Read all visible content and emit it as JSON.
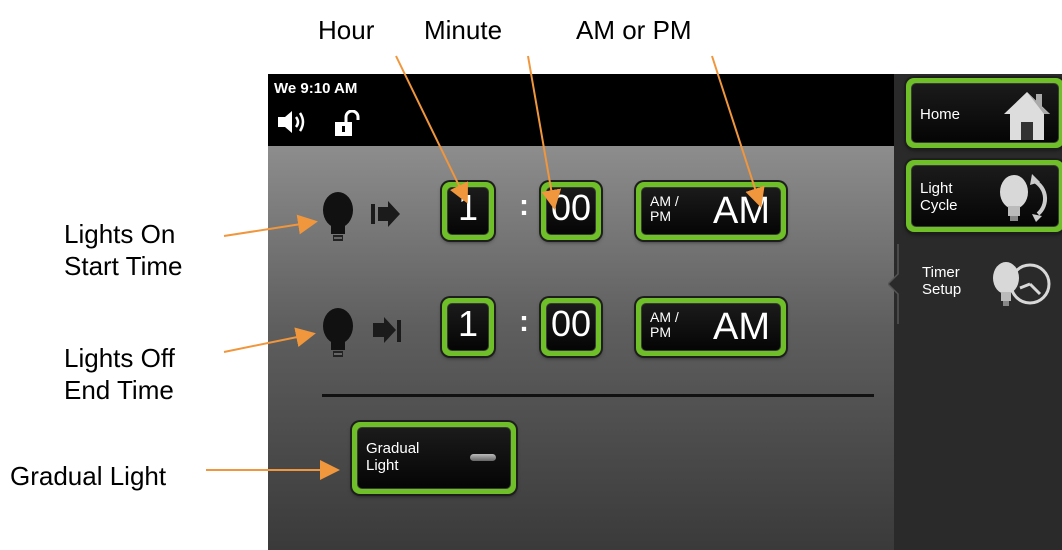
{
  "callouts": {
    "hour": "Hour",
    "minute": "Minute",
    "am_or_pm": "AM or PM",
    "lights_on_line1": "Lights On",
    "lights_on_line2": "Start Time",
    "lights_off_line1": "Lights Off",
    "lights_off_line2": "End Time",
    "gradual_light": "Gradual Light"
  },
  "status_bar": {
    "datetime": "We 9:10 AM",
    "icons": [
      "speaker-icon",
      "unlocked-padlock-icon"
    ]
  },
  "lights_on": {
    "icon": "bulb-arrow-right-icon",
    "hour": "1",
    "separator": ":",
    "minute": "00",
    "ampm_label_line1": "AM /",
    "ampm_label_line2": "PM",
    "ampm_value": "AM"
  },
  "lights_off": {
    "icon": "bulb-arrow-stop-icon",
    "hour": "1",
    "separator": ":",
    "minute": "00",
    "ampm_label_line1": "AM /",
    "ampm_label_line2": "PM",
    "ampm_value": "AM"
  },
  "gradual_light": {
    "label_line1": "Gradual",
    "label_line2": "Light",
    "toggle_state": "off"
  },
  "sidebar": {
    "home_label": "Home",
    "light_cycle_line1": "Light",
    "light_cycle_line2": "Cycle",
    "timer_setup_line1": "Timer",
    "timer_setup_line2": "Setup"
  },
  "colors": {
    "accent_green": "#6fbf28",
    "callout_arrow": "#f0963c",
    "panel_black": "#000000"
  }
}
